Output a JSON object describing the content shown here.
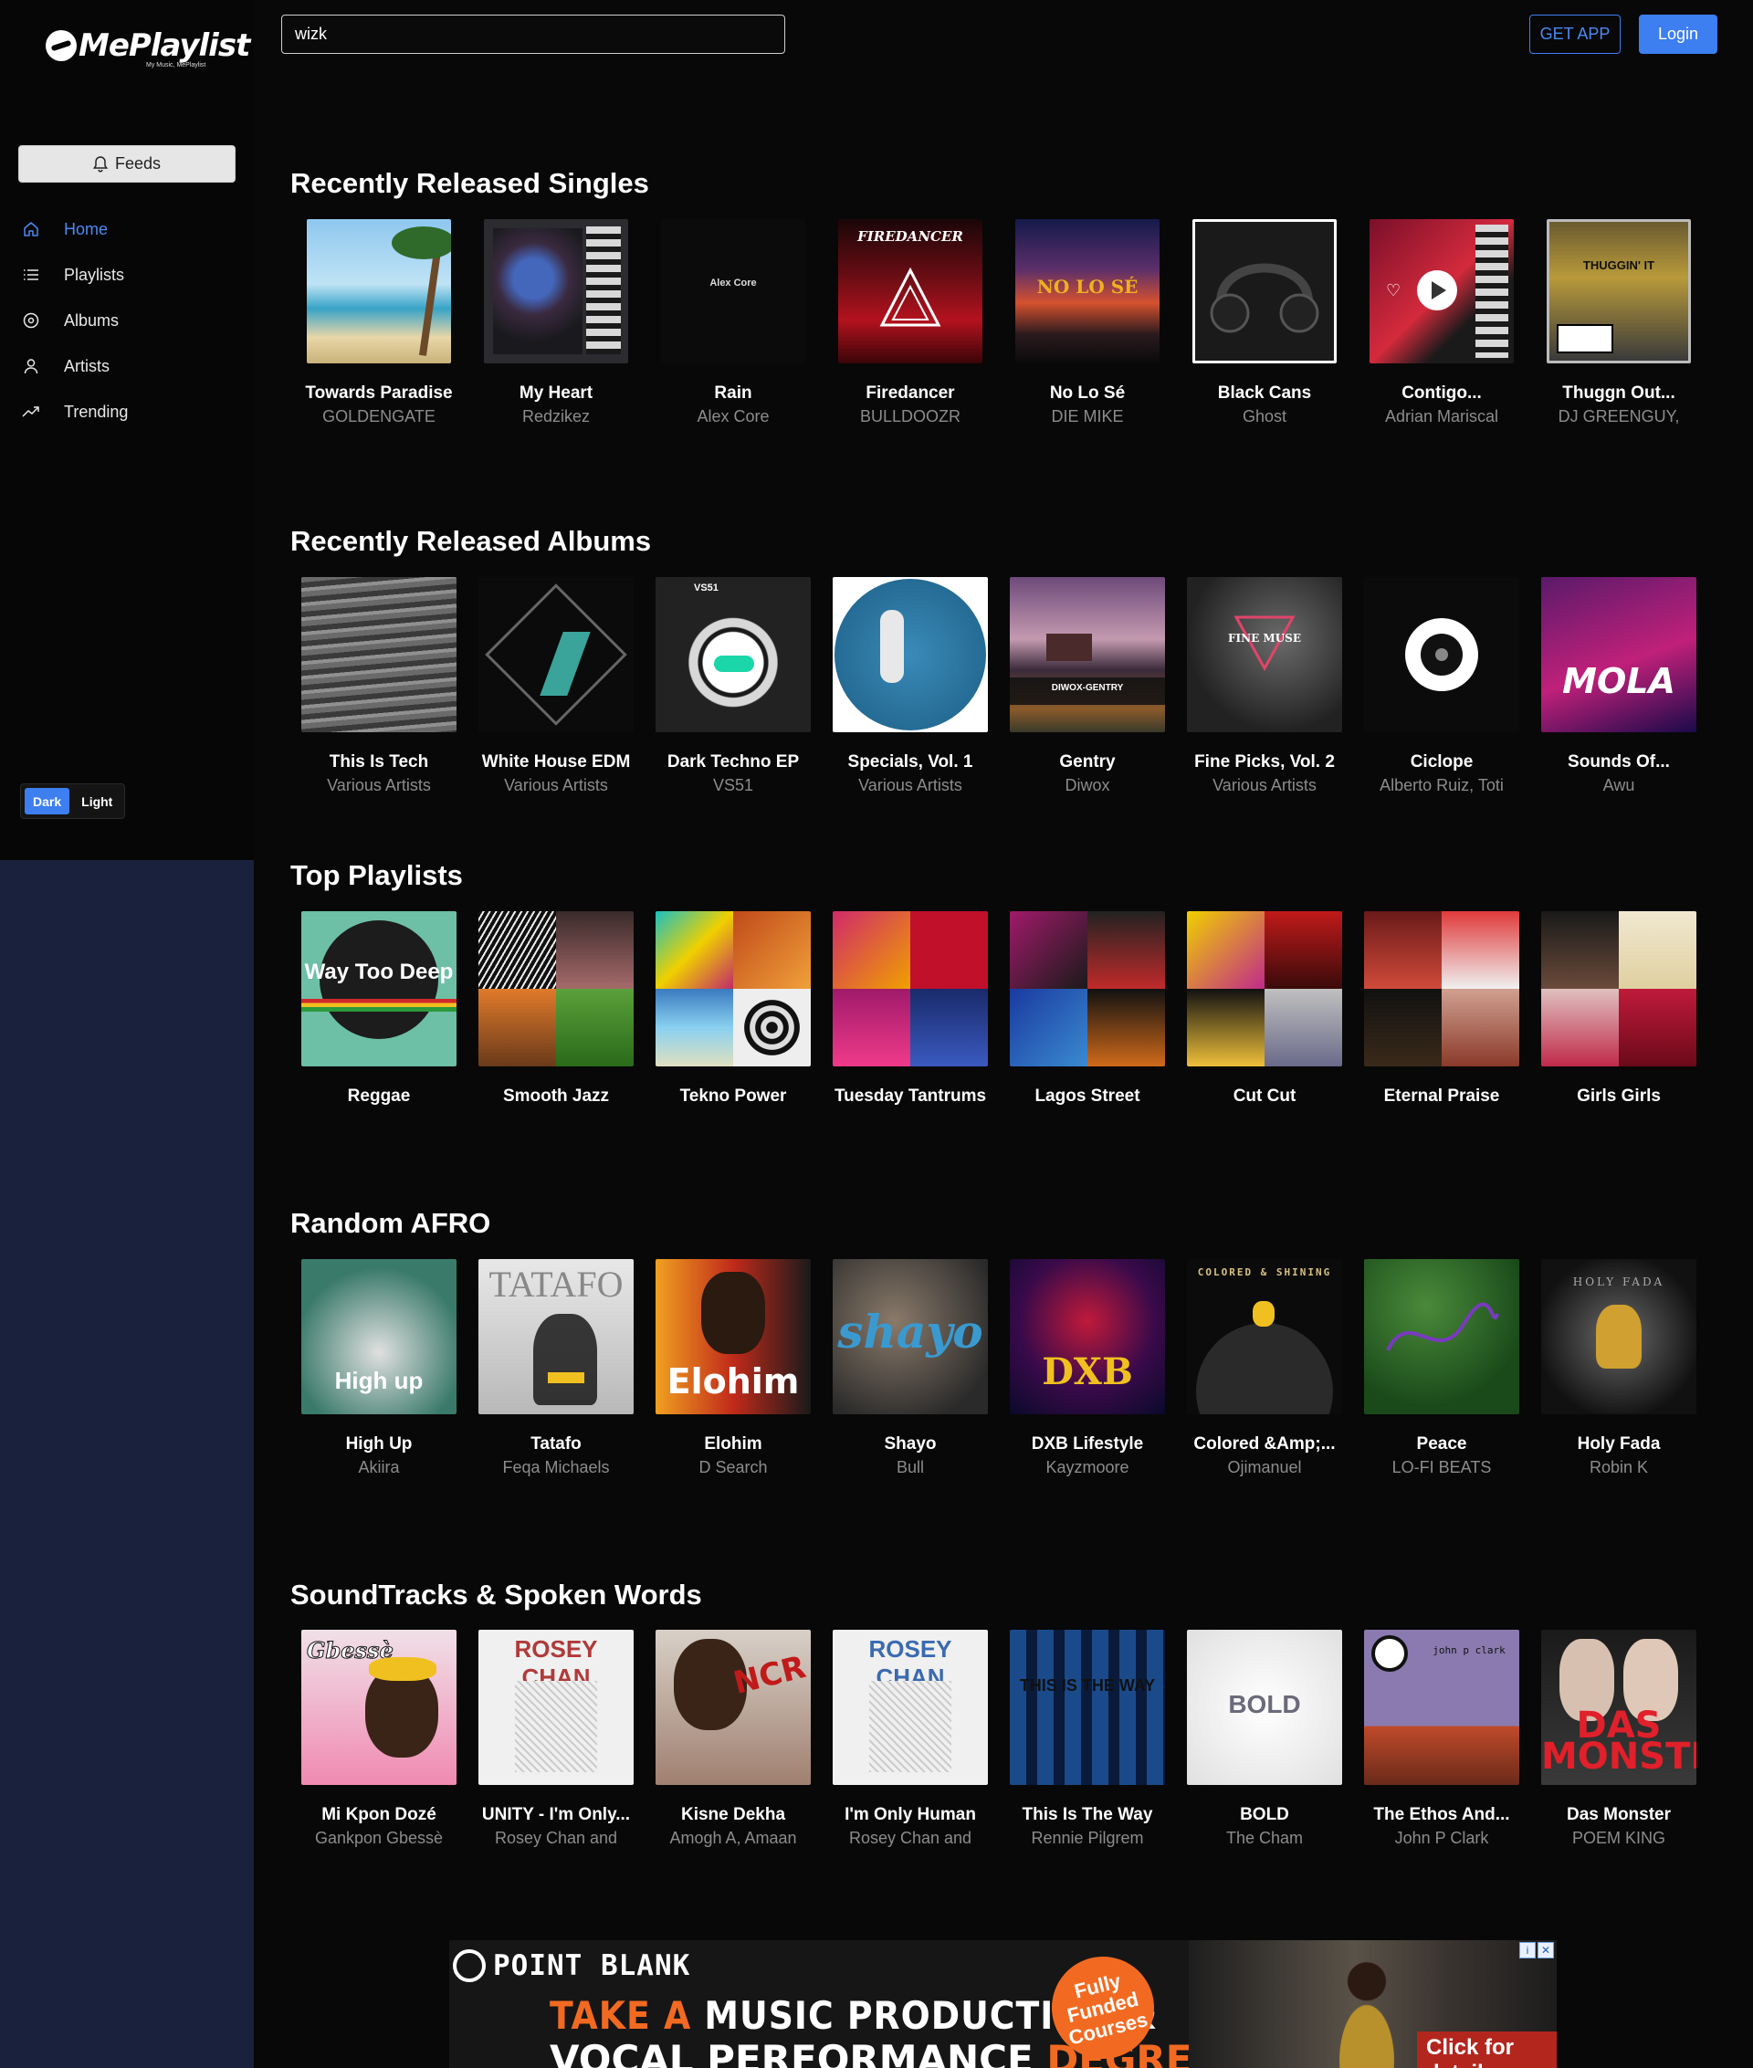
{
  "app": {
    "logo_text": "MePlaylist",
    "logo_tm": "™",
    "logo_tagline": "My Music, MePlaylist"
  },
  "sidebar": {
    "feeds_label": "Feeds",
    "items": [
      {
        "label": "Home",
        "icon": "home-icon"
      },
      {
        "label": "Playlists",
        "icon": "list-icon"
      },
      {
        "label": "Albums",
        "icon": "disc-icon"
      },
      {
        "label": "Artists",
        "icon": "user-icon"
      },
      {
        "label": "Trending",
        "icon": "trending-icon"
      }
    ],
    "theme": {
      "dark_label": "Dark",
      "light_label": "Light"
    }
  },
  "header": {
    "search_value": "wizk",
    "get_app_label": "GET APP",
    "login_label": "Login"
  },
  "colors": {
    "accent": "#3d7ef0",
    "page_bg": "#080808",
    "sidebar_bg": "#060606",
    "body_bg": "#19213d"
  },
  "sections": [
    {
      "title": "Recently Released Singles",
      "items": [
        {
          "title": "Towards Paradise",
          "sub": "GOLDENGATE"
        },
        {
          "title": "My Heart",
          "sub": "Redzikez"
        },
        {
          "title": "Rain",
          "sub": "Alex Core"
        },
        {
          "title": "Firedancer",
          "sub": "BULLDOOZR"
        },
        {
          "title": "No Lo Sé",
          "sub": "DIE MIKE"
        },
        {
          "title": "Black Cans",
          "sub": "Ghost"
        },
        {
          "title": "Contigo...",
          "sub": "Adrian Mariscal"
        },
        {
          "title": "Thuggn Out...",
          "sub": "DJ GREENGUY,"
        }
      ]
    },
    {
      "title": "Recently Released Albums",
      "items": [
        {
          "title": "This Is Tech",
          "sub": "Various Artists"
        },
        {
          "title": "White House EDM",
          "sub": "Various Artists"
        },
        {
          "title": "Dark Techno EP",
          "sub": "VS51"
        },
        {
          "title": "Specials, Vol. 1",
          "sub": "Various Artists"
        },
        {
          "title": "Gentry",
          "sub": "Diwox"
        },
        {
          "title": "Fine Picks, Vol. 2",
          "sub": "Various Artists"
        },
        {
          "title": "Ciclope",
          "sub": "Alberto Ruiz, Toti"
        },
        {
          "title": "Sounds Of...",
          "sub": "Awu"
        }
      ]
    },
    {
      "title": "Top Playlists",
      "items": [
        {
          "title": "Reggae",
          "sub": ""
        },
        {
          "title": "Smooth Jazz",
          "sub": ""
        },
        {
          "title": "Tekno Power",
          "sub": ""
        },
        {
          "title": "Tuesday Tantrums",
          "sub": ""
        },
        {
          "title": "Lagos Street",
          "sub": ""
        },
        {
          "title": "Cut Cut",
          "sub": ""
        },
        {
          "title": "Eternal Praise",
          "sub": ""
        },
        {
          "title": "Girls Girls",
          "sub": ""
        }
      ]
    },
    {
      "title": "Random AFRO",
      "items": [
        {
          "title": "High Up",
          "sub": "Akiira"
        },
        {
          "title": "Tatafo",
          "sub": "Feqa Michaels"
        },
        {
          "title": "Elohim",
          "sub": "D Search"
        },
        {
          "title": "Shayo",
          "sub": "Bull"
        },
        {
          "title": "DXB Lifestyle",
          "sub": "Kayzmoore"
        },
        {
          "title": "Colored &Amp;...",
          "sub": "Ojimanuel"
        },
        {
          "title": "Peace",
          "sub": "LO-FI BEATS"
        },
        {
          "title": "Holy Fada",
          "sub": "Robin K"
        }
      ]
    },
    {
      "title": "SoundTracks & Spoken Words",
      "items": [
        {
          "title": "Mi Kpon Dozé",
          "sub": "Gankpon Gbessè"
        },
        {
          "title": "UNITY - I'm Only...",
          "sub": "Rosey Chan and"
        },
        {
          "title": "Kisne Dekha",
          "sub": "Amogh A, Amaan"
        },
        {
          "title": "I'm Only Human",
          "sub": "Rosey Chan and"
        },
        {
          "title": "This Is The Way",
          "sub": "Rennie Pilgrem"
        },
        {
          "title": "BOLD",
          "sub": "The Cham"
        },
        {
          "title": "The Ethos And...",
          "sub": "John P Clark"
        },
        {
          "title": "Das Monster",
          "sub": "POEM KING"
        }
      ]
    }
  ],
  "cover_text": {
    "s0": [
      "",
      "",
      "Alex Core",
      "FIREDANCER",
      "NO LO SÉ",
      "",
      "",
      "THUGGIN' IT"
    ],
    "s1": [
      "",
      "",
      "VS51",
      "",
      "DIWOX-GENTRY",
      "FINE MUSE",
      "",
      "MOLA"
    ],
    "s2": [
      "Way Too Deep",
      "",
      "",
      "",
      "",
      "",
      "",
      ""
    ],
    "s3": [
      "High up",
      "TATAFO",
      "Elohim",
      "shayo",
      "DXB",
      "COLORED & SHINING",
      "",
      "HOLY FADA"
    ],
    "s4": [
      "Gbessè",
      "ROSEY CHAN",
      "NCR",
      "ROSEY CHAN",
      "THIS IS THE WAY",
      "BOLD",
      "john p clark",
      "DAS MONSTER"
    ]
  },
  "ad": {
    "brand": "POINT BLANK",
    "line1_hl": "TAKE A",
    "line1": "MUSIC PRODUCTION &",
    "line2": "VOCAL PERFORMANCE",
    "line2_hl": "DEGREE",
    "badge": "Fully Funded Courses",
    "cta": "Click for details"
  }
}
